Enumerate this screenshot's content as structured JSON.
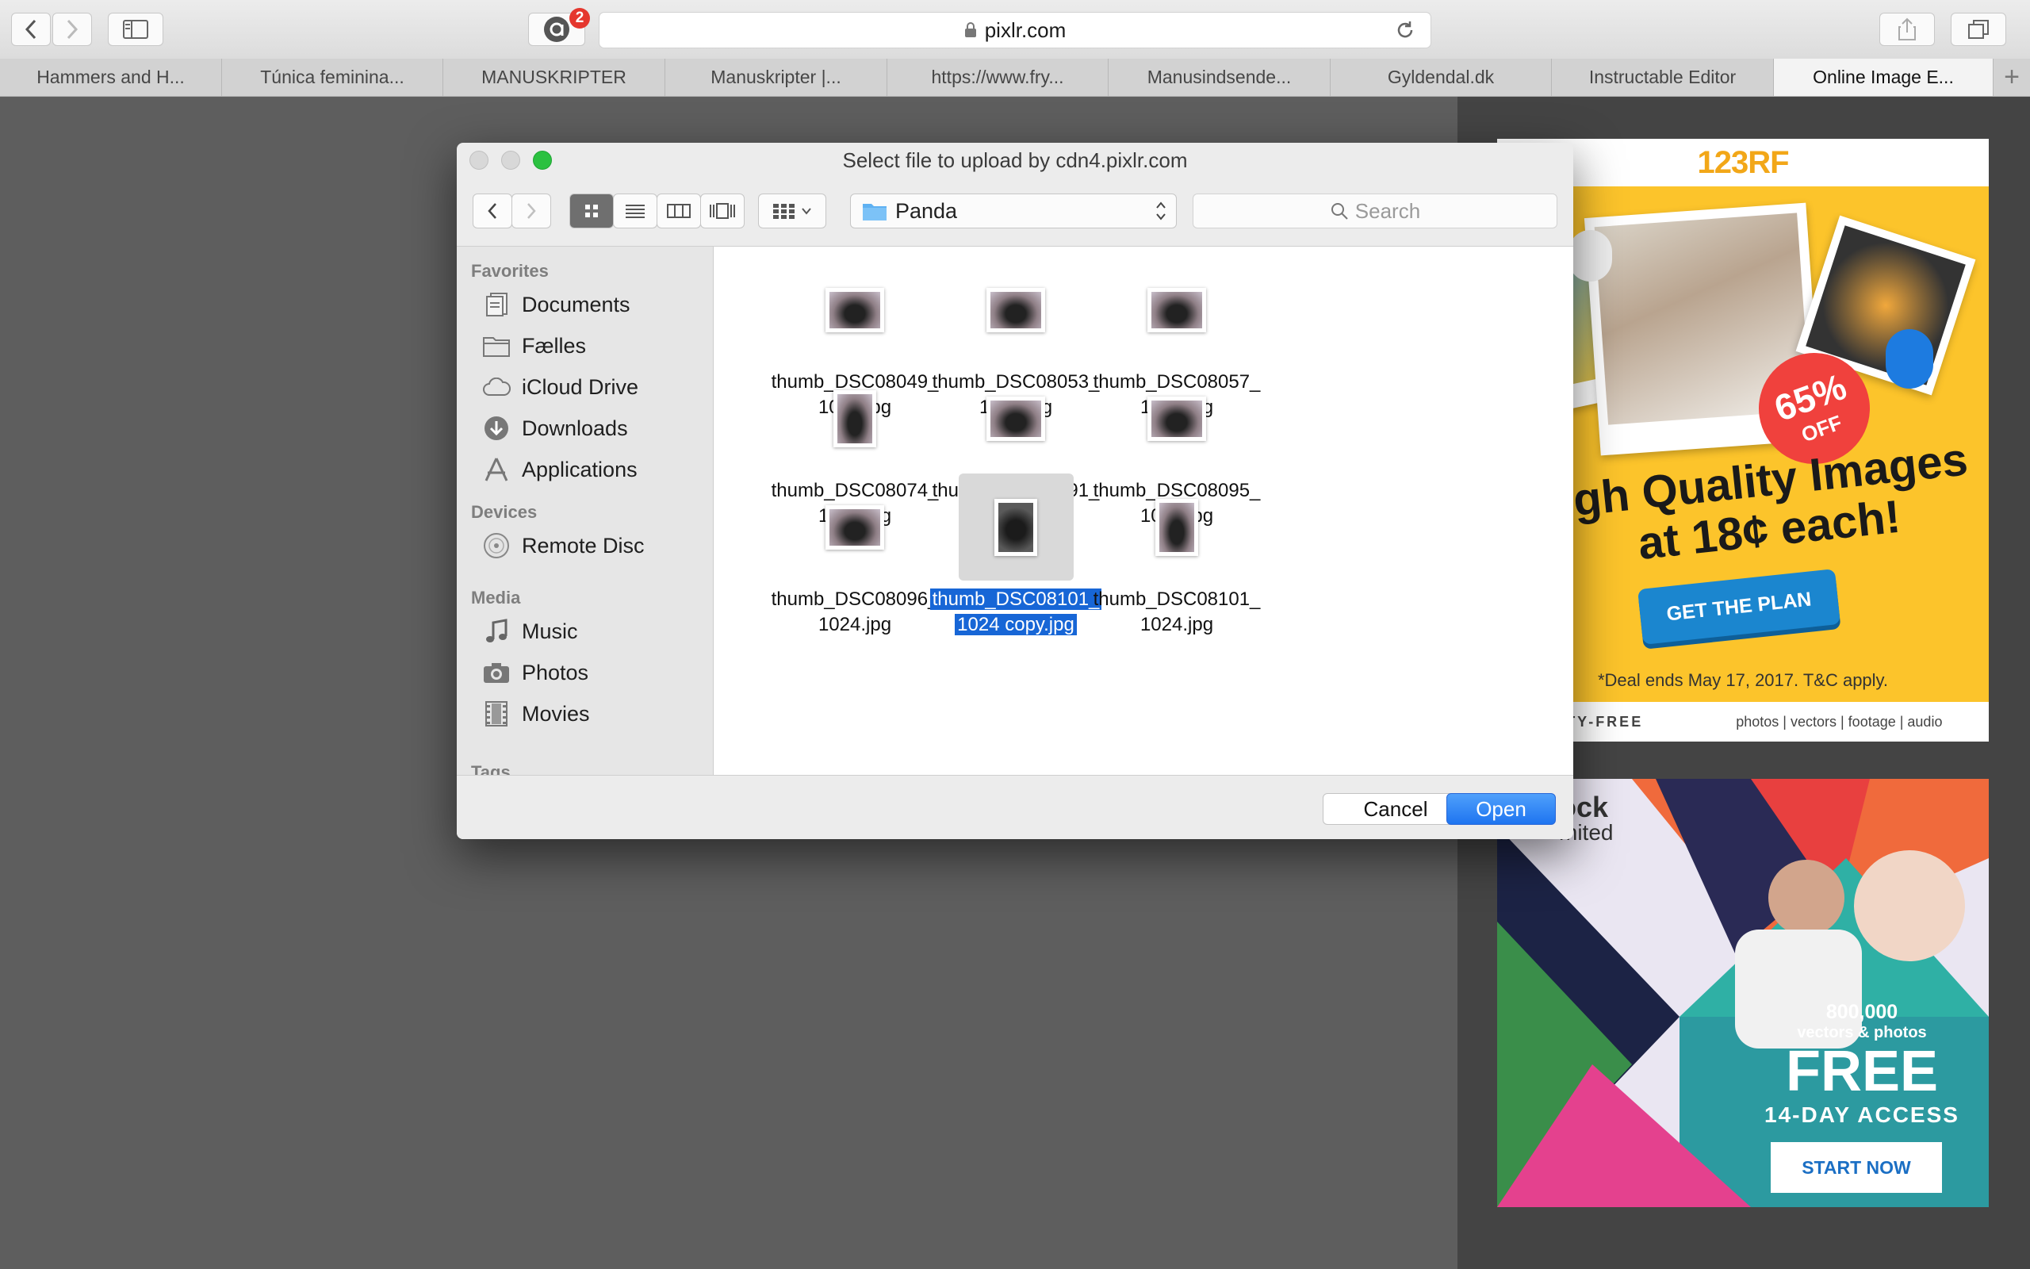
{
  "browser": {
    "url": "pixlr.com",
    "extension_badge": "2"
  },
  "tabs": [
    {
      "label": "Hammers and H..."
    },
    {
      "label": "Túnica feminina..."
    },
    {
      "label": "MANUSKRIPTER"
    },
    {
      "label": "Manuskripter |..."
    },
    {
      "label": "https://www.fry..."
    },
    {
      "label": "Manusindsende..."
    },
    {
      "label": "Gyldendal.dk"
    },
    {
      "label": "Instructable Editor"
    },
    {
      "label": "Online Image E..."
    }
  ],
  "dialog": {
    "title": "Select file to upload by cdn4.pixlr.com",
    "path": "Panda",
    "search_placeholder": "Search",
    "sidebar": {
      "favorites_header": "Favorites",
      "favorites": [
        {
          "label": "Documents",
          "icon": "documents-icon"
        },
        {
          "label": "Fælles",
          "icon": "folder-icon"
        },
        {
          "label": "iCloud Drive",
          "icon": "cloud-icon"
        },
        {
          "label": "Downloads",
          "icon": "downloads-icon"
        },
        {
          "label": "Applications",
          "icon": "applications-icon"
        }
      ],
      "devices_header": "Devices",
      "devices": [
        {
          "label": "Remote Disc",
          "icon": "disc-icon"
        }
      ],
      "media_header": "Media",
      "media": [
        {
          "label": "Music",
          "icon": "music-icon"
        },
        {
          "label": "Photos",
          "icon": "camera-icon"
        },
        {
          "label": "Movies",
          "icon": "film-icon"
        }
      ],
      "tags_header": "Tags"
    },
    "files": [
      {
        "line1": "thumb_DSC08049_",
        "line2": "1024.jpg",
        "orientation": "landscape",
        "selected": false
      },
      {
        "line1": "thumb_DSC08053_",
        "line2": "1024.jpg",
        "orientation": "landscape",
        "selected": false
      },
      {
        "line1": "thumb_DSC08057_",
        "line2": "1024.jpg",
        "orientation": "landscape",
        "selected": false
      },
      {
        "line1": "thumb_DSC08074_",
        "line2": "1024.jpg",
        "orientation": "portrait",
        "selected": false
      },
      {
        "line1": "thumb_DSC08091_",
        "line2": "1024.jpg",
        "orientation": "landscape",
        "selected": false
      },
      {
        "line1": "thumb_DSC08095_",
        "line2": "1024.jpg",
        "orientation": "landscape",
        "selected": false
      },
      {
        "line1": "thumb_DSC08096_",
        "line2": "1024.jpg",
        "orientation": "landscape",
        "selected": false
      },
      {
        "line1": "thumb_DSC08101_",
        "line2": "1024 copy.jpg",
        "orientation": "portrait",
        "selected": true
      },
      {
        "line1": "thumb_DSC08101_",
        "line2": "1024.jpg",
        "orientation": "portrait",
        "selected": false
      }
    ],
    "cancel_label": "Cancel",
    "open_label": "Open"
  },
  "ads": {
    "ad1": {
      "logo": "123RF",
      "badge_big": "65%",
      "badge_small": "OFF",
      "headline_1": "igh Quality Images",
      "headline_2": "at 18¢ each!",
      "cta": "GET THE PLAN",
      "deal": "*Deal ends May 17, 2017. T&C apply.",
      "footer_left": "ALTY-FREE",
      "footer_right": "photos | vectors | footage | audio"
    },
    "ad2": {
      "logo_1": "ock",
      "logo_2": "mited",
      "count": "800,000",
      "count_sub": "vectors & photos",
      "free": "FREE",
      "access": "14-DAY ACCESS",
      "cta": "START NOW"
    }
  },
  "colors": {
    "accent_blue": "#1766d6",
    "open_button": "#2f86f5",
    "ad_yellow": "#fcc42b"
  }
}
